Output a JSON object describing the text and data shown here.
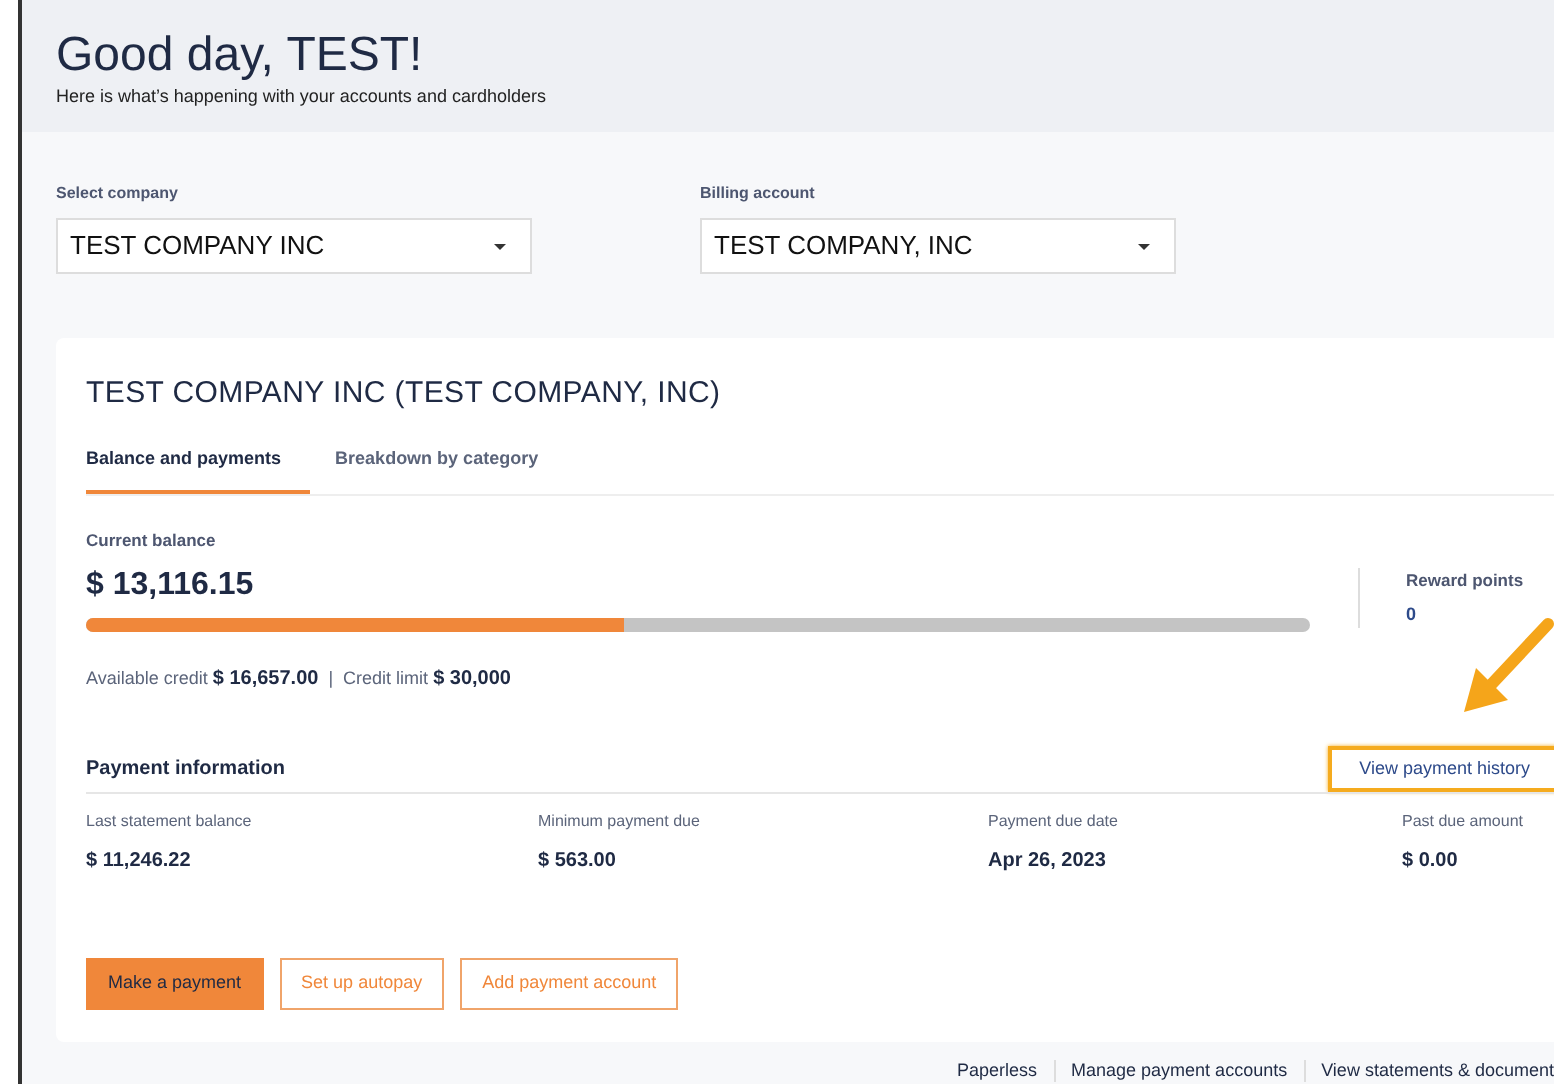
{
  "header": {
    "greeting": "Good day,",
    "name": "TEST!",
    "subtitle": "Here is what’s happening with your accounts and cardholders"
  },
  "selectors": [
    {
      "label": "Select company",
      "value": "TEST COMPANY INC"
    },
    {
      "label": "Billing account",
      "value": "TEST COMPANY, INC"
    }
  ],
  "account": {
    "title": "TEST COMPANY INC (TEST COMPANY, INC)",
    "tabs": [
      {
        "label": "Balance and payments",
        "selected": true
      },
      {
        "label": "Breakdown by category",
        "selected": false
      }
    ],
    "balance": {
      "label": "Current balance",
      "amount": "$ 13,116.15",
      "level": 0.44,
      "available_label": "Available credit",
      "available": "$ 16,657.00",
      "separator": "|",
      "limit_label": "Credit limit",
      "limit": "$ 30,000"
    },
    "rewards": {
      "label": "Reward points",
      "value": "0"
    },
    "payment_info": {
      "title": "Payment information",
      "link": "View payment history",
      "highlighted": true,
      "items": [
        {
          "label": "Last statement balance",
          "value": "$ 11,246.22"
        },
        {
          "label": "Minimum payment due",
          "value": "$ 563.00"
        },
        {
          "label": "Payment due date",
          "value": "Apr 26, 2023"
        },
        {
          "label": "Past due amount",
          "value": "$ 0.00"
        }
      ]
    },
    "buttons": [
      {
        "label": "Make a payment",
        "kind": "primary"
      },
      {
        "label": "Set up autopay",
        "kind": "outline"
      },
      {
        "label": "Add payment account",
        "kind": "outline"
      }
    ]
  },
  "footer_links": [
    "Paperless",
    "Manage payment accounts",
    "View statements & document"
  ]
}
